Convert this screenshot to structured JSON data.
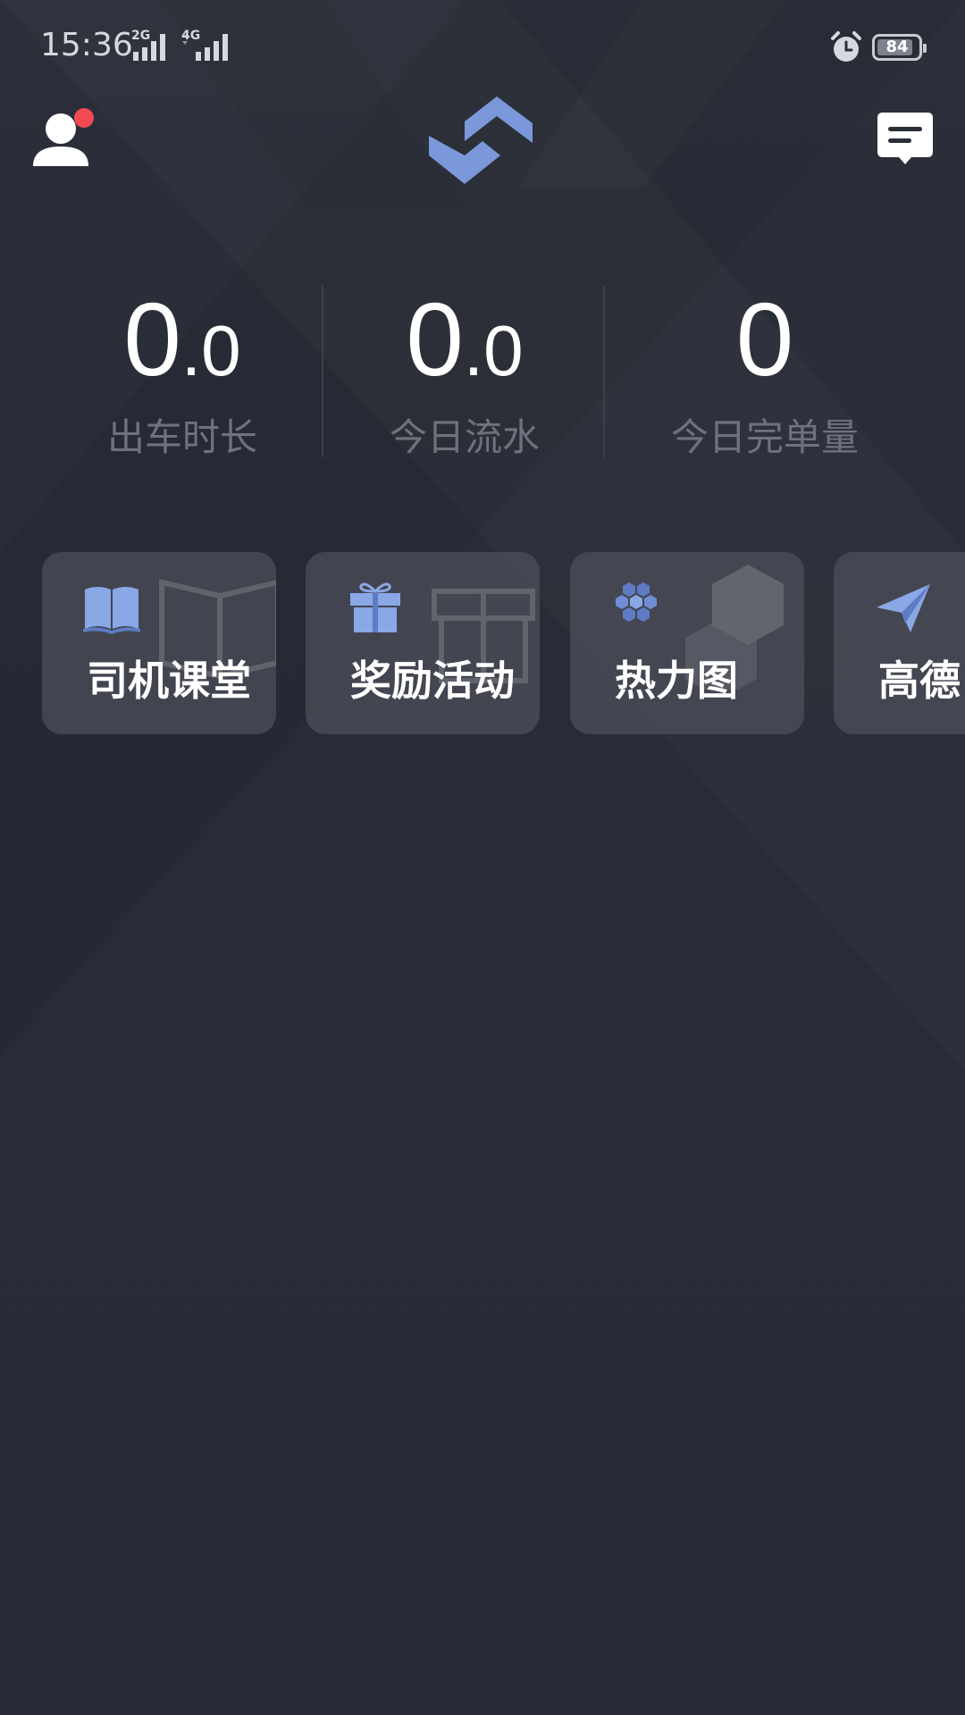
{
  "status_bar": {
    "time": "15:36",
    "network_1": "2G",
    "network_2": "4G",
    "battery_level": 84,
    "battery_text": "84",
    "icons": [
      "signal-icon",
      "alarm-icon",
      "battery-icon"
    ]
  },
  "header": {
    "icons": {
      "profile": "user-icon",
      "logo": "app-logo-icon",
      "message": "message-icon"
    },
    "notification_color": "#f24a55"
  },
  "stats": [
    {
      "value_int": "0",
      "value_dec": ".0",
      "label": "出车时长"
    },
    {
      "value_int": "0",
      "value_dec": ".0",
      "label": "今日流水"
    },
    {
      "value_int": "0",
      "value_dec": "",
      "label": "今日完单量"
    }
  ],
  "cards": [
    {
      "label": "司机课堂",
      "icon": "book-icon"
    },
    {
      "label": "奖励活动",
      "icon": "gift-icon"
    },
    {
      "label": "热力图",
      "icon": "hexagon-grid-icon"
    },
    {
      "label": "高德",
      "icon": "paper-plane-icon"
    }
  ],
  "colors": {
    "background": "#282c37",
    "card_background": "#4d515c",
    "accent": "#7b98da",
    "label_muted": "#6d727d"
  }
}
